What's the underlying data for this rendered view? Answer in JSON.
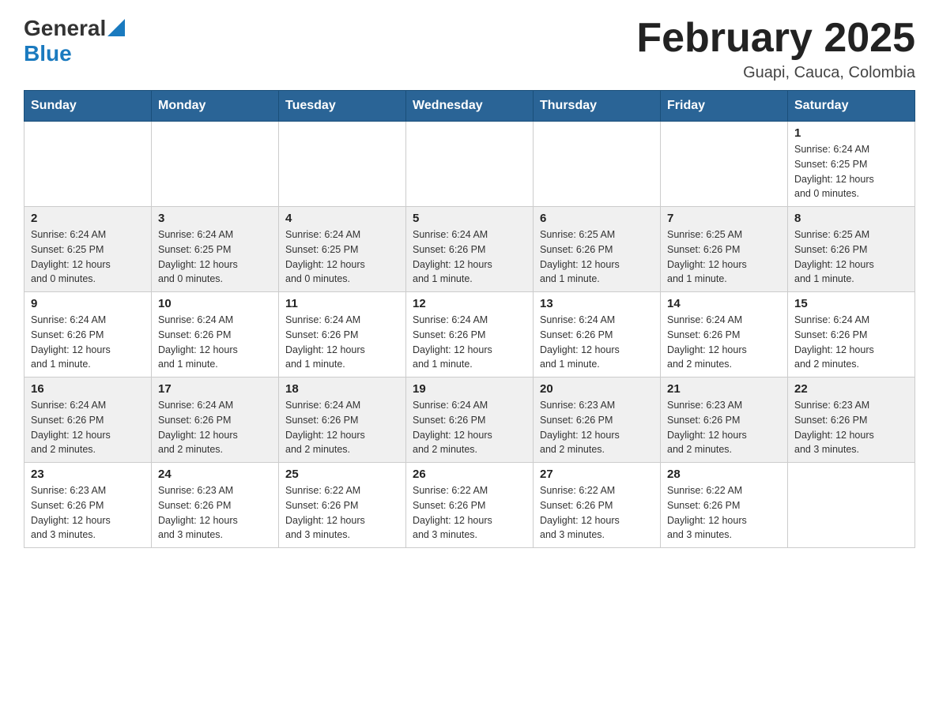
{
  "header": {
    "logo_text_general": "General",
    "logo_text_blue": "Blue",
    "main_title": "February 2025",
    "subtitle": "Guapi, Cauca, Colombia"
  },
  "calendar": {
    "days_of_week": [
      "Sunday",
      "Monday",
      "Tuesday",
      "Wednesday",
      "Thursday",
      "Friday",
      "Saturday"
    ],
    "weeks": [
      [
        {
          "day": "",
          "info": ""
        },
        {
          "day": "",
          "info": ""
        },
        {
          "day": "",
          "info": ""
        },
        {
          "day": "",
          "info": ""
        },
        {
          "day": "",
          "info": ""
        },
        {
          "day": "",
          "info": ""
        },
        {
          "day": "1",
          "info": "Sunrise: 6:24 AM\nSunset: 6:25 PM\nDaylight: 12 hours\nand 0 minutes."
        }
      ],
      [
        {
          "day": "2",
          "info": "Sunrise: 6:24 AM\nSunset: 6:25 PM\nDaylight: 12 hours\nand 0 minutes."
        },
        {
          "day": "3",
          "info": "Sunrise: 6:24 AM\nSunset: 6:25 PM\nDaylight: 12 hours\nand 0 minutes."
        },
        {
          "day": "4",
          "info": "Sunrise: 6:24 AM\nSunset: 6:25 PM\nDaylight: 12 hours\nand 0 minutes."
        },
        {
          "day": "5",
          "info": "Sunrise: 6:24 AM\nSunset: 6:26 PM\nDaylight: 12 hours\nand 1 minute."
        },
        {
          "day": "6",
          "info": "Sunrise: 6:25 AM\nSunset: 6:26 PM\nDaylight: 12 hours\nand 1 minute."
        },
        {
          "day": "7",
          "info": "Sunrise: 6:25 AM\nSunset: 6:26 PM\nDaylight: 12 hours\nand 1 minute."
        },
        {
          "day": "8",
          "info": "Sunrise: 6:25 AM\nSunset: 6:26 PM\nDaylight: 12 hours\nand 1 minute."
        }
      ],
      [
        {
          "day": "9",
          "info": "Sunrise: 6:24 AM\nSunset: 6:26 PM\nDaylight: 12 hours\nand 1 minute."
        },
        {
          "day": "10",
          "info": "Sunrise: 6:24 AM\nSunset: 6:26 PM\nDaylight: 12 hours\nand 1 minute."
        },
        {
          "day": "11",
          "info": "Sunrise: 6:24 AM\nSunset: 6:26 PM\nDaylight: 12 hours\nand 1 minute."
        },
        {
          "day": "12",
          "info": "Sunrise: 6:24 AM\nSunset: 6:26 PM\nDaylight: 12 hours\nand 1 minute."
        },
        {
          "day": "13",
          "info": "Sunrise: 6:24 AM\nSunset: 6:26 PM\nDaylight: 12 hours\nand 1 minute."
        },
        {
          "day": "14",
          "info": "Sunrise: 6:24 AM\nSunset: 6:26 PM\nDaylight: 12 hours\nand 2 minutes."
        },
        {
          "day": "15",
          "info": "Sunrise: 6:24 AM\nSunset: 6:26 PM\nDaylight: 12 hours\nand 2 minutes."
        }
      ],
      [
        {
          "day": "16",
          "info": "Sunrise: 6:24 AM\nSunset: 6:26 PM\nDaylight: 12 hours\nand 2 minutes."
        },
        {
          "day": "17",
          "info": "Sunrise: 6:24 AM\nSunset: 6:26 PM\nDaylight: 12 hours\nand 2 minutes."
        },
        {
          "day": "18",
          "info": "Sunrise: 6:24 AM\nSunset: 6:26 PM\nDaylight: 12 hours\nand 2 minutes."
        },
        {
          "day": "19",
          "info": "Sunrise: 6:24 AM\nSunset: 6:26 PM\nDaylight: 12 hours\nand 2 minutes."
        },
        {
          "day": "20",
          "info": "Sunrise: 6:23 AM\nSunset: 6:26 PM\nDaylight: 12 hours\nand 2 minutes."
        },
        {
          "day": "21",
          "info": "Sunrise: 6:23 AM\nSunset: 6:26 PM\nDaylight: 12 hours\nand 2 minutes."
        },
        {
          "day": "22",
          "info": "Sunrise: 6:23 AM\nSunset: 6:26 PM\nDaylight: 12 hours\nand 3 minutes."
        }
      ],
      [
        {
          "day": "23",
          "info": "Sunrise: 6:23 AM\nSunset: 6:26 PM\nDaylight: 12 hours\nand 3 minutes."
        },
        {
          "day": "24",
          "info": "Sunrise: 6:23 AM\nSunset: 6:26 PM\nDaylight: 12 hours\nand 3 minutes."
        },
        {
          "day": "25",
          "info": "Sunrise: 6:22 AM\nSunset: 6:26 PM\nDaylight: 12 hours\nand 3 minutes."
        },
        {
          "day": "26",
          "info": "Sunrise: 6:22 AM\nSunset: 6:26 PM\nDaylight: 12 hours\nand 3 minutes."
        },
        {
          "day": "27",
          "info": "Sunrise: 6:22 AM\nSunset: 6:26 PM\nDaylight: 12 hours\nand 3 minutes."
        },
        {
          "day": "28",
          "info": "Sunrise: 6:22 AM\nSunset: 6:26 PM\nDaylight: 12 hours\nand 3 minutes."
        },
        {
          "day": "",
          "info": ""
        }
      ]
    ]
  }
}
